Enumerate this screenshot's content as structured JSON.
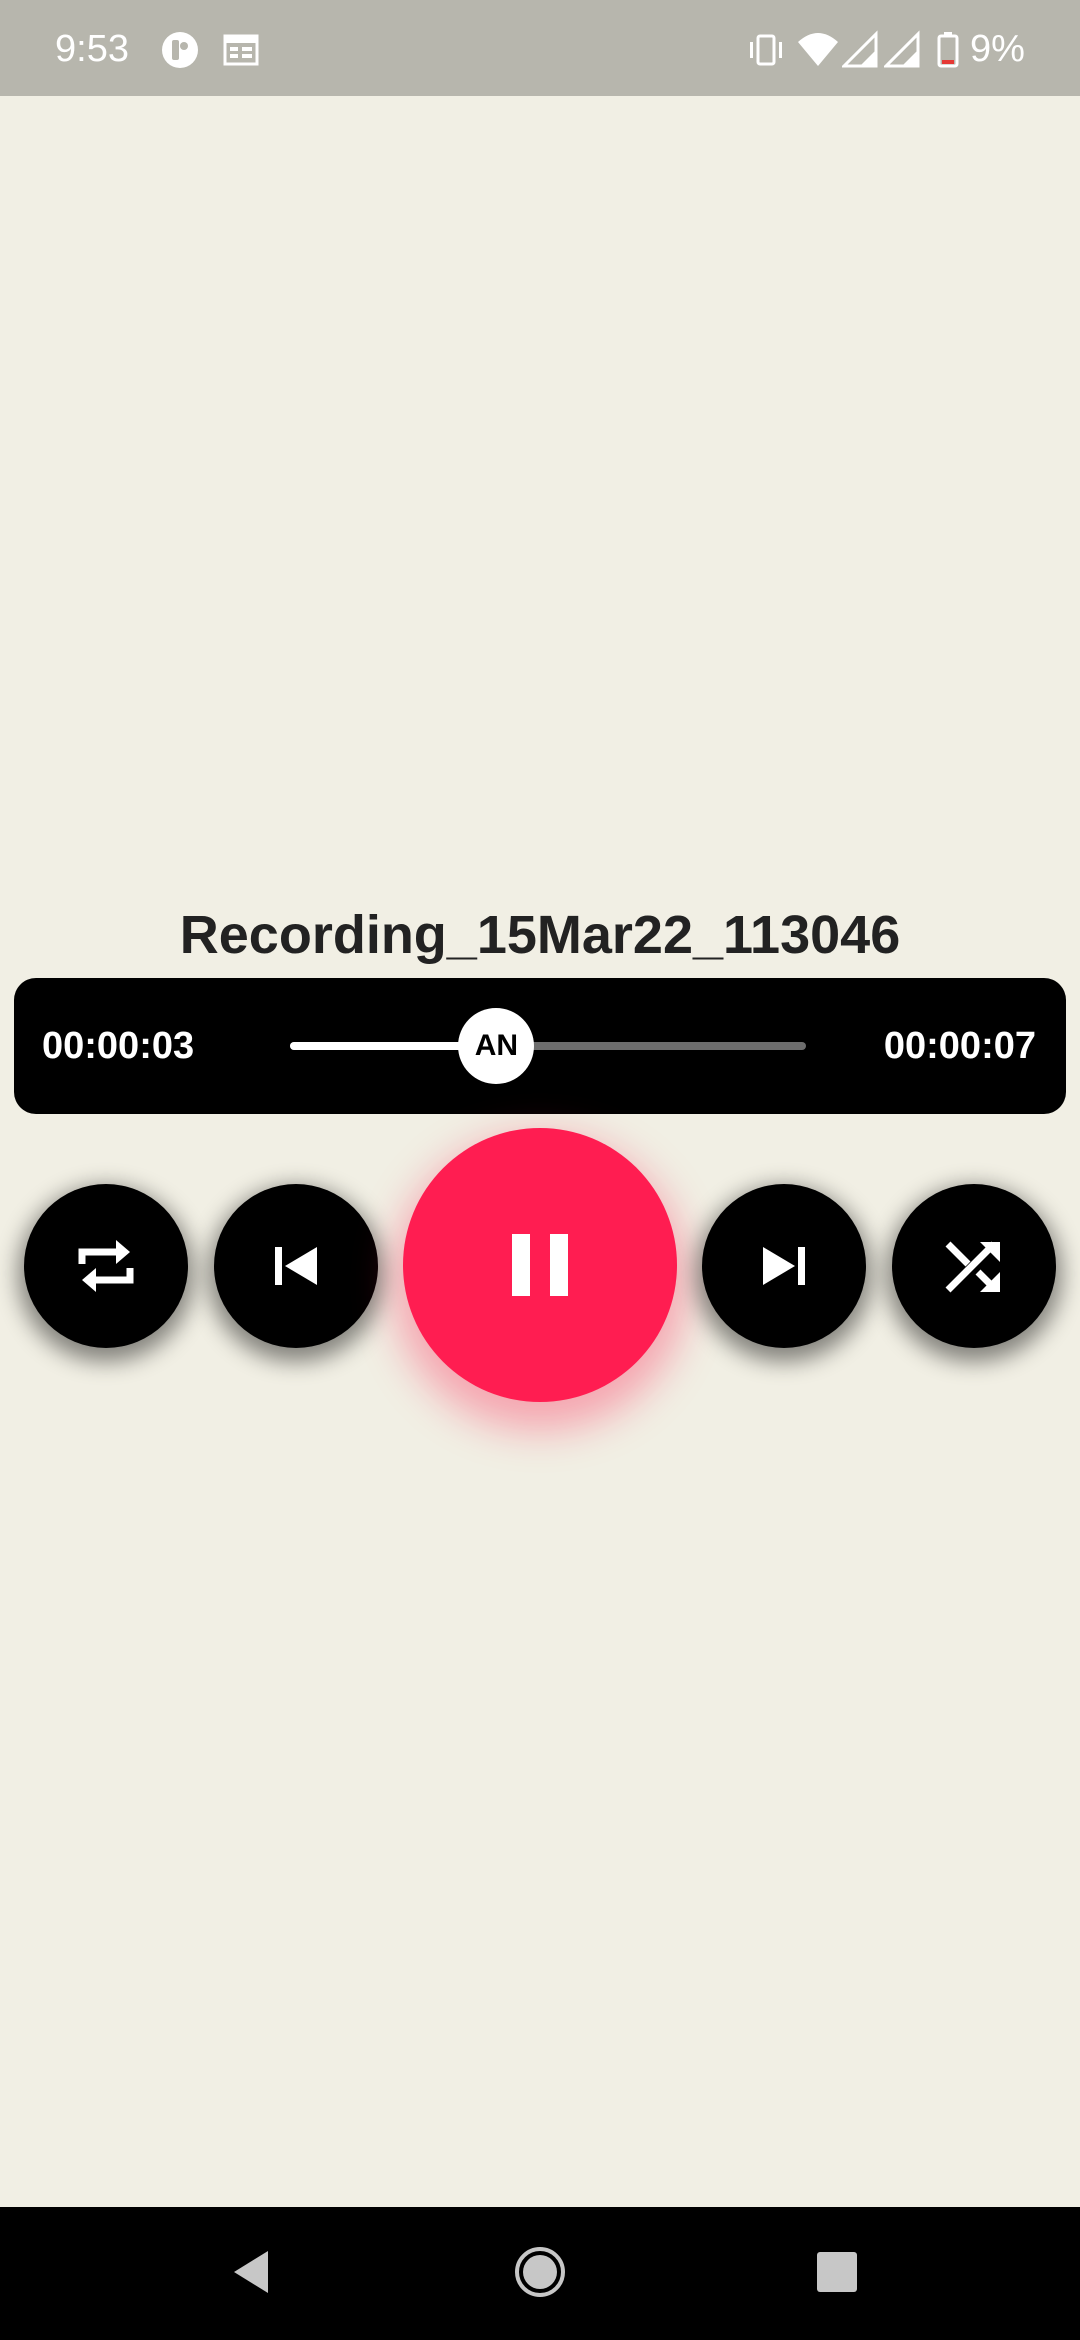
{
  "status_bar": {
    "time": "9:53",
    "battery_percent": "9%",
    "icons": [
      "app-notification-icon",
      "calendar-icon",
      "vibrate-icon",
      "wifi-icon",
      "signal-icon",
      "signal-icon",
      "battery-low-icon"
    ]
  },
  "player": {
    "title": "Recording_15Mar22_113046",
    "elapsed": "00:00:03",
    "total": "00:00:07",
    "progress_fraction": 0.4,
    "thumb_label": "AN"
  },
  "controls": {
    "buttons": [
      "repeat-icon",
      "skip-previous-icon",
      "pause-icon",
      "skip-next-icon",
      "shuffle-icon"
    ],
    "play_color": "#ff1d51"
  },
  "navigation": {
    "buttons": [
      "back-triangle-icon",
      "home-circle-icon",
      "recents-square-icon"
    ]
  },
  "colors": {
    "background": "#f1efe4",
    "status_bar": "#b7b6ad",
    "accent": "#ff1d51"
  }
}
